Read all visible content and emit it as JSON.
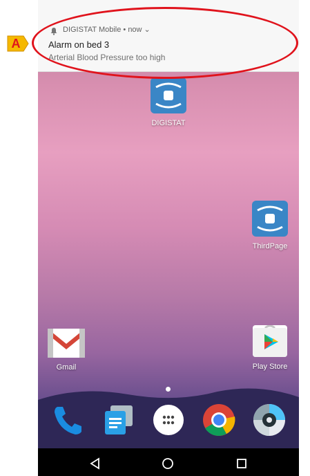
{
  "notification": {
    "app_line": "DIGISTAT Mobile • now ⌄",
    "title": "Alarm on bed 3",
    "text": "Arterial Blood Pressure too high"
  },
  "apps": {
    "digistat_label": "DIGISTAT",
    "thirdpage_label": "ThirdPage",
    "gmail_label": "Gmail",
    "playstore_label": "Play Store"
  },
  "dock": [
    {
      "name": "phone-icon"
    },
    {
      "name": "messages-icon"
    },
    {
      "name": "app-drawer-icon"
    },
    {
      "name": "chrome-icon"
    },
    {
      "name": "camera-icon"
    }
  ],
  "annotation": {
    "badge_letter": "A"
  },
  "colors": {
    "annotation": "#e0131c",
    "badge": "#f5b800",
    "digistat_blue": "#3a86c6"
  }
}
